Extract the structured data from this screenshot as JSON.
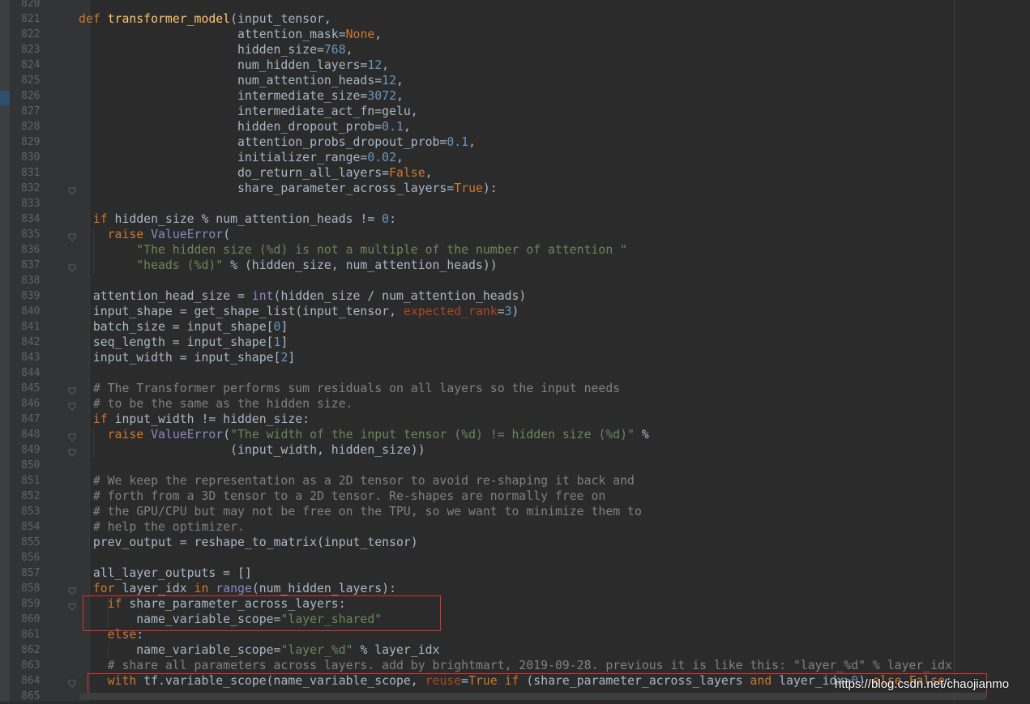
{
  "editor": {
    "language": "python",
    "lines": [
      {
        "n": "820",
        "t": []
      },
      {
        "n": "821",
        "t": [
          [
            "kw",
            "def "
          ],
          [
            "fn",
            "transformer_model"
          ],
          [
            "",
            "(input_tensor,"
          ]
        ]
      },
      {
        "n": "822",
        "t": [
          [
            "",
            "                      attention_mask="
          ],
          [
            "kw",
            "None"
          ],
          [
            "",
            ","
          ]
        ]
      },
      {
        "n": "823",
        "t": [
          [
            "",
            "                      hidden_size="
          ],
          [
            "num",
            "768"
          ],
          [
            "",
            ","
          ]
        ]
      },
      {
        "n": "824",
        "t": [
          [
            "",
            "                      num_hidden_layers="
          ],
          [
            "num",
            "12"
          ],
          [
            "",
            ","
          ]
        ]
      },
      {
        "n": "825",
        "t": [
          [
            "",
            "                      num_attention_heads="
          ],
          [
            "num",
            "12"
          ],
          [
            "",
            ","
          ]
        ]
      },
      {
        "n": "826",
        "t": [
          [
            "",
            "                      intermediate_size="
          ],
          [
            "num",
            "3072"
          ],
          [
            "",
            ","
          ]
        ]
      },
      {
        "n": "827",
        "t": [
          [
            "",
            "                      intermediate_act_fn=gelu,"
          ]
        ]
      },
      {
        "n": "828",
        "t": [
          [
            "",
            "                      hidden_dropout_prob="
          ],
          [
            "num",
            "0.1"
          ],
          [
            "",
            ","
          ]
        ]
      },
      {
        "n": "829",
        "t": [
          [
            "",
            "                      attention_probs_dropout_prob="
          ],
          [
            "num",
            "0.1"
          ],
          [
            "",
            ","
          ]
        ]
      },
      {
        "n": "830",
        "t": [
          [
            "",
            "                      initializer_range="
          ],
          [
            "num",
            "0.02"
          ],
          [
            "",
            ","
          ]
        ]
      },
      {
        "n": "831",
        "t": [
          [
            "",
            "                      do_return_all_layers="
          ],
          [
            "kw",
            "False"
          ],
          [
            "",
            ","
          ]
        ]
      },
      {
        "n": "832",
        "t": [
          [
            "",
            "                      share_parameter_across_layers="
          ],
          [
            "kw",
            "True"
          ],
          [
            "",
            "):"
          ]
        ]
      },
      {
        "n": "833",
        "t": []
      },
      {
        "n": "834",
        "t": [
          [
            "kw",
            "  if "
          ],
          [
            "",
            "hidden_size % num_attention_heads != "
          ],
          [
            "num",
            "0"
          ],
          [
            "",
            ":"
          ]
        ]
      },
      {
        "n": "835",
        "t": [
          [
            "kw",
            "    raise "
          ],
          [
            "bi",
            "ValueError"
          ],
          [
            "",
            "("
          ]
        ]
      },
      {
        "n": "836",
        "t": [
          [
            "str",
            "        \"The hidden size (%d) is not a multiple of the number of attention \""
          ]
        ]
      },
      {
        "n": "837",
        "t": [
          [
            "str",
            "        \"heads (%d)\""
          ],
          [
            "",
            " % (hidden_size, num_attention_heads))"
          ]
        ]
      },
      {
        "n": "838",
        "t": []
      },
      {
        "n": "839",
        "t": [
          [
            "",
            "  attention_head_size = "
          ],
          [
            "bi",
            "int"
          ],
          [
            "",
            "(hidden_size / num_attention_heads)"
          ]
        ]
      },
      {
        "n": "840",
        "t": [
          [
            "",
            "  input_shape = get_shape_list(input_tensor, "
          ],
          [
            "pm",
            "expected_rank"
          ],
          [
            "",
            "="
          ],
          [
            "num",
            "3"
          ],
          [
            "",
            ")"
          ]
        ]
      },
      {
        "n": "841",
        "t": [
          [
            "",
            "  batch_size = input_shape["
          ],
          [
            "num",
            "0"
          ],
          [
            "",
            "]"
          ]
        ]
      },
      {
        "n": "842",
        "t": [
          [
            "",
            "  seq_length = input_shape["
          ],
          [
            "num",
            "1"
          ],
          [
            "",
            "]"
          ]
        ]
      },
      {
        "n": "843",
        "t": [
          [
            "",
            "  input_width = input_shape["
          ],
          [
            "num",
            "2"
          ],
          [
            "",
            "]"
          ]
        ]
      },
      {
        "n": "844",
        "t": []
      },
      {
        "n": "845",
        "t": [
          [
            "cm",
            "  # The Transformer performs sum residuals on all layers so the input needs"
          ]
        ]
      },
      {
        "n": "846",
        "t": [
          [
            "cm",
            "  # to be the same as the hidden size."
          ]
        ]
      },
      {
        "n": "847",
        "t": [
          [
            "kw",
            "  if "
          ],
          [
            "",
            "input_width != hidden_size:"
          ]
        ]
      },
      {
        "n": "848",
        "t": [
          [
            "kw",
            "    raise "
          ],
          [
            "bi",
            "ValueError"
          ],
          [
            "",
            "("
          ],
          [
            "str",
            "\"The width of the input tensor (%d) != hidden size (%d)\""
          ],
          [
            "",
            " %"
          ]
        ]
      },
      {
        "n": "849",
        "t": [
          [
            "",
            "                     (input_width, hidden_size))"
          ]
        ]
      },
      {
        "n": "850",
        "t": []
      },
      {
        "n": "851",
        "t": [
          [
            "cm",
            "  # We keep the representation as a 2D tensor to avoid re-shaping it back and"
          ]
        ]
      },
      {
        "n": "852",
        "t": [
          [
            "cm",
            "  # forth from a 3D tensor to a 2D tensor. Re-shapes are normally free on"
          ]
        ]
      },
      {
        "n": "853",
        "t": [
          [
            "cm",
            "  # the GPU/CPU but may not be free on the TPU, so we want to minimize them to"
          ]
        ]
      },
      {
        "n": "854",
        "t": [
          [
            "cm",
            "  # help the optimizer."
          ]
        ]
      },
      {
        "n": "855",
        "t": [
          [
            "",
            "  prev_output = reshape_to_matrix(input_tensor)"
          ]
        ]
      },
      {
        "n": "856",
        "t": []
      },
      {
        "n": "857",
        "t": [
          [
            "",
            "  all_layer_outputs = []"
          ]
        ]
      },
      {
        "n": "858",
        "t": [
          [
            "kw",
            "  for "
          ],
          [
            "",
            "layer_idx "
          ],
          [
            "kw",
            "in "
          ],
          [
            "bi",
            "range"
          ],
          [
            "",
            "(num_hidden_layers):"
          ]
        ]
      },
      {
        "n": "859",
        "t": [
          [
            "kw",
            "    if "
          ],
          [
            "",
            "share_parameter_across_layers:"
          ]
        ]
      },
      {
        "n": "860",
        "t": [
          [
            "",
            "        name_variable_scope="
          ],
          [
            "str",
            "\"layer_shared\""
          ]
        ]
      },
      {
        "n": "861",
        "t": [
          [
            "kw",
            "    else"
          ],
          [
            "",
            ":"
          ]
        ]
      },
      {
        "n": "862",
        "t": [
          [
            "",
            "        name_variable_scope="
          ],
          [
            "str",
            "\"layer_%d\""
          ],
          [
            "",
            " % layer_idx"
          ]
        ]
      },
      {
        "n": "863",
        "t": [
          [
            "cm",
            "    # share all parameters across layers. add by brightmart, 2019-09-28. previous it is like this: \"layer_%d\" % layer_idx"
          ]
        ]
      },
      {
        "n": "864",
        "t": [
          [
            "kw",
            "    with "
          ],
          [
            "",
            "tf.variable_scope(name_variable_scope, "
          ],
          [
            "pm",
            "reuse"
          ],
          [
            "",
            "="
          ],
          [
            "kw",
            "True "
          ],
          [
            "kw",
            "if "
          ],
          [
            "",
            "(share_parameter_across_layers "
          ],
          [
            "kw",
            "and "
          ],
          [
            "",
            "layer_idx>"
          ],
          [
            "num",
            "0"
          ],
          [
            "",
            ") "
          ],
          [
            "kw",
            "else False"
          ],
          [
            "",
            ":"
          ]
        ]
      },
      {
        "n": "865",
        "t": []
      }
    ],
    "fold_markers_at": [
      "832",
      "835",
      "837",
      "845",
      "846",
      "848",
      "849",
      "858",
      "859",
      "864"
    ]
  },
  "watermark": "https://blog.csdn.net/chaojianmo",
  "colors": {
    "background": "#2b2b2b",
    "keyword": "#cc7832",
    "function": "#ffc66d",
    "number": "#6897bb",
    "string": "#6a8759",
    "comment": "#808080",
    "builtin": "#8888c6",
    "highlight_box": "#e03030"
  }
}
